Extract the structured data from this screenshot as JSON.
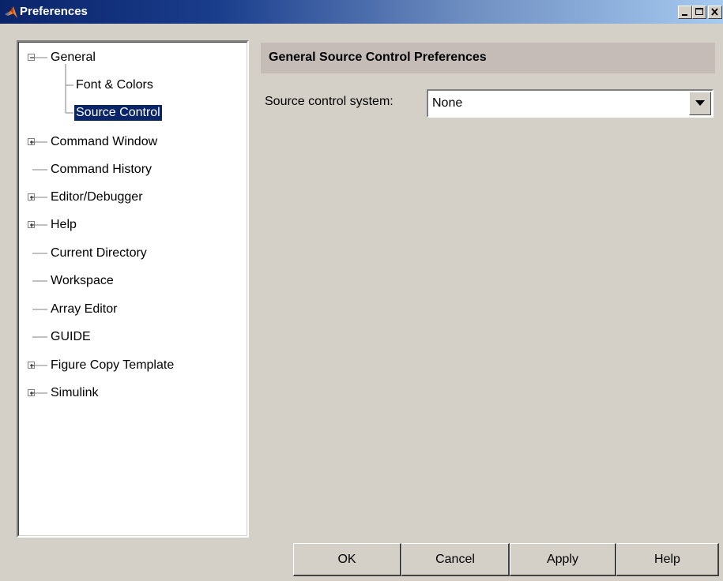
{
  "window": {
    "title": "Preferences",
    "icon": "matlab-logo-icon",
    "controls": [
      "minimize-icon",
      "maximize-icon",
      "close-icon"
    ]
  },
  "tree": {
    "items": [
      {
        "label": "General",
        "expander": "minus",
        "level": 0
      },
      {
        "label": "Font & Colors",
        "level": 1
      },
      {
        "label": "Source Control",
        "level": 1,
        "selected": true
      },
      {
        "label": "Command Window",
        "expander": "plus",
        "level": 0
      },
      {
        "label": "Command History",
        "level": 0
      },
      {
        "label": "Editor/Debugger",
        "expander": "plus",
        "level": 0
      },
      {
        "label": "Help",
        "expander": "plus",
        "level": 0
      },
      {
        "label": "Current Directory",
        "level": 0
      },
      {
        "label": "Workspace",
        "level": 0
      },
      {
        "label": "Array Editor",
        "level": 0
      },
      {
        "label": "GUIDE",
        "level": 0
      },
      {
        "label": "Figure Copy Template",
        "expander": "plus",
        "level": 0
      },
      {
        "label": "Simulink",
        "expander": "plus",
        "level": 0
      }
    ]
  },
  "panel": {
    "title": "General Source Control Preferences",
    "source_control_label": "Source control system:",
    "source_control_value": "None"
  },
  "buttons": {
    "ok": "OK",
    "cancel": "Cancel",
    "apply": "Apply",
    "help": "Help"
  },
  "colors": {
    "selection": "#0a246a",
    "header_bar": "#c5bcb8",
    "face": "#d4d0c8"
  }
}
